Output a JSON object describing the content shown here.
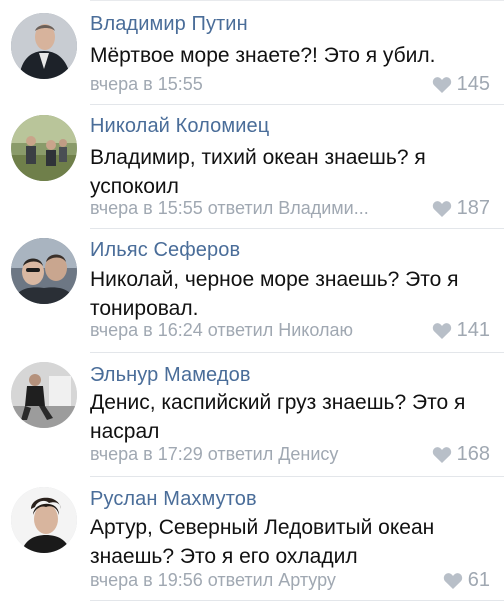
{
  "comments": [
    {
      "author": "Владимир Путин",
      "text": "Мёртвое море знаете?! Это я убил.",
      "meta": "вчера в 15:55",
      "likes": "145",
      "avatar_icon": "person-in-suit-photo"
    },
    {
      "author": "Николай Коломиец",
      "text": "Владимир, тихий океан знаешь? я успокоил",
      "meta": "вчера в 15:55 ответил Владими...",
      "likes": "187",
      "avatar_icon": "group-outdoors-photo"
    },
    {
      "author": "Ильяс Сеферов",
      "text": "Николай, черное море знаешь? Это я тонировал.",
      "meta": "вчера в 16:24 ответил Николаю",
      "likes": "141",
      "avatar_icon": "two-faces-photo"
    },
    {
      "author": "Эльнур Мамедов",
      "text": "Денис, каспийский груз знаешь? Это я насрал",
      "meta": "вчера в 17:29 ответил Денису",
      "likes": "168",
      "avatar_icon": "person-sitting-photo"
    },
    {
      "author": "Руслан Махмутов",
      "text": "Артур, Северный Ледовитый океан знаешь? Это я его охладил",
      "meta": "вчера в 19:56 ответил Артуру",
      "likes": "61",
      "avatar_icon": "portrait-photo"
    }
  ],
  "colors": {
    "author": "#4a6d99",
    "meta": "#a0a8b2",
    "text": "#111111",
    "divider": "#e3e6ea"
  }
}
